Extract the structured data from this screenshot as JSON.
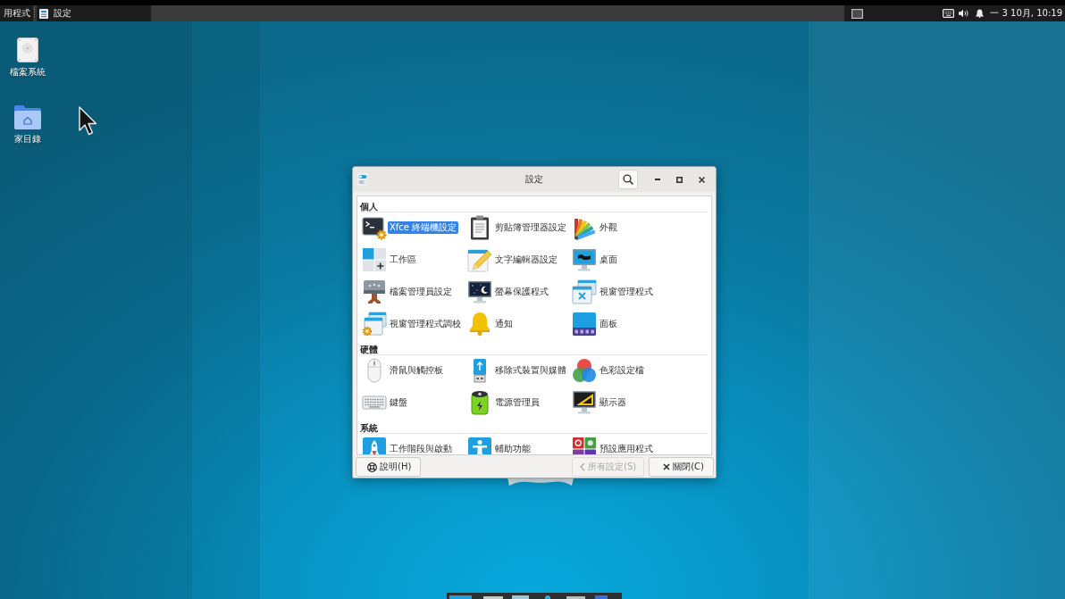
{
  "top_panel": {
    "app_menu": "用程式",
    "tasks": [
      {
        "label": "設定",
        "selected": true
      }
    ],
    "clock": "一 3 10月, 10:19"
  },
  "desktop_icons": [
    {
      "label": "檔案系統",
      "kind": "drive"
    },
    {
      "label": "家目錄",
      "kind": "home-folder"
    }
  ],
  "settings_window": {
    "title": "設定",
    "sections": [
      {
        "title": "個人",
        "items": [
          {
            "label": "Xfce 終端機設定",
            "kind": "terminal",
            "selected": true
          },
          {
            "label": "剪貼簿管理器設定",
            "kind": "clipboard",
            "selected": false
          },
          {
            "label": "外觀",
            "kind": "appearance",
            "selected": false
          },
          {
            "label": "工作區",
            "kind": "workspaces",
            "selected": false
          },
          {
            "label": "文字編輯器設定",
            "kind": "text-editor",
            "selected": false
          },
          {
            "label": "桌面",
            "kind": "desktop",
            "selected": false
          },
          {
            "label": "檔案管理員設定",
            "kind": "file-manager",
            "selected": false
          },
          {
            "label": "螢幕保護程式",
            "kind": "screensaver",
            "selected": false
          },
          {
            "label": "視窗管理程式",
            "kind": "window-manager",
            "selected": false
          },
          {
            "label": "視窗管理程式調校",
            "kind": "wm-tweaks",
            "selected": false
          },
          {
            "label": "通知",
            "kind": "notifications",
            "selected": false
          },
          {
            "label": "面板",
            "kind": "panel",
            "selected": false
          }
        ]
      },
      {
        "title": "硬體",
        "items": [
          {
            "label": "滑鼠與觸控板",
            "kind": "mouse",
            "selected": false
          },
          {
            "label": "移除式裝置與媒體",
            "kind": "removable",
            "selected": false
          },
          {
            "label": "色彩設定檔",
            "kind": "color",
            "selected": false
          },
          {
            "label": "鍵盤",
            "kind": "keyboard",
            "selected": false
          },
          {
            "label": "電源管理員",
            "kind": "power",
            "selected": false
          },
          {
            "label": "顯示器",
            "kind": "display",
            "selected": false
          }
        ]
      },
      {
        "title": "系統",
        "items": [
          {
            "label": "工作階段與啟動",
            "kind": "session",
            "selected": false
          },
          {
            "label": "輔助功能",
            "kind": "accessibility",
            "selected": false
          },
          {
            "label": "預設應用程式",
            "kind": "default-apps",
            "selected": false
          }
        ]
      }
    ],
    "buttons": [
      {
        "label": "說明(H)",
        "kind": "help",
        "disabled": false
      },
      {
        "label": "所有設定(S)",
        "kind": "back",
        "disabled": true
      },
      {
        "label": "關閉(C)",
        "kind": "close",
        "disabled": false
      }
    ]
  }
}
